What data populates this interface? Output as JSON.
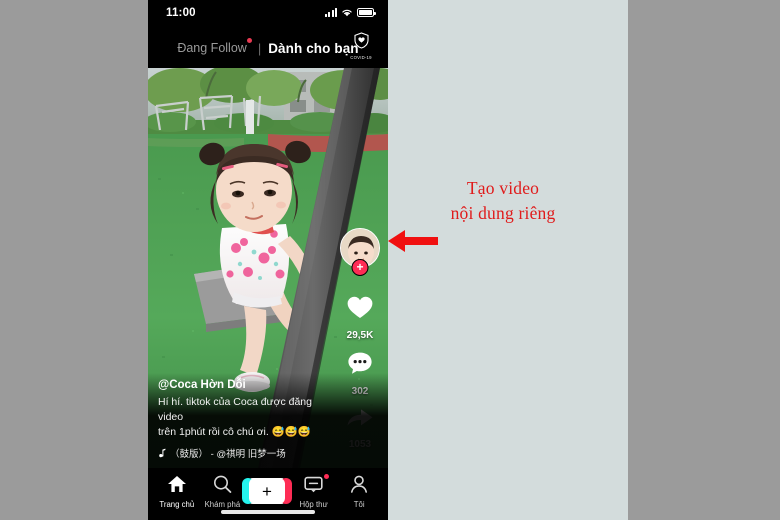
{
  "annotation": {
    "line1": "Tạo video",
    "line2": "nội dung riêng",
    "color": "#e01b1b",
    "arrow_icon": "arrow-left-icon"
  },
  "phone": {
    "status_bar": {
      "time": "11:00",
      "signal_icon": "cellular-signal-icon",
      "wifi_icon": "wifi-icon",
      "battery_icon": "battery-full-icon"
    },
    "top_nav": {
      "following_tab": "Đang Follow",
      "separator": "|",
      "foryou_tab": "Dành cho bạn",
      "covid_label": "COVID-19",
      "covid_icon": "shield-heart-icon"
    },
    "video": {
      "username": "@Coca Hờn Dỗi",
      "caption_line1": "Hí hí. tiktok của Coca được đăng video",
      "caption_line2": "trên 1phút rồi cô chú ơi. 😅😅😅",
      "music_note_icon": "music-note-icon",
      "music_text": "（鼓版） - @祺明   旧梦一场"
    },
    "actions": {
      "avatar_icon": "profile-avatar",
      "follow_icon": "plus-follow-icon",
      "like_icon": "heart-icon",
      "like_count": "29,5K",
      "comment_icon": "comment-bubble-icon",
      "comment_count": "302",
      "share_icon": "share-arrow-icon",
      "share_count": "1053",
      "disc_icon": "spinning-record-icon"
    },
    "bottom_nav": [
      {
        "label": "Trang chủ",
        "icon": "home-icon",
        "active": true
      },
      {
        "label": "Khám phá",
        "icon": "search-icon",
        "active": false
      },
      {
        "label": "",
        "icon": "create-plus-icon",
        "active": false
      },
      {
        "label": "Hộp thư",
        "icon": "inbox-message-icon",
        "active": false
      },
      {
        "label": "Tôi",
        "icon": "person-profile-icon",
        "active": false
      }
    ]
  },
  "colors": {
    "page_background": "#9b9b9b",
    "panel_background": "#d3dcdc",
    "accent_red": "#fe2c55",
    "accent_cyan": "#25f4ee"
  }
}
